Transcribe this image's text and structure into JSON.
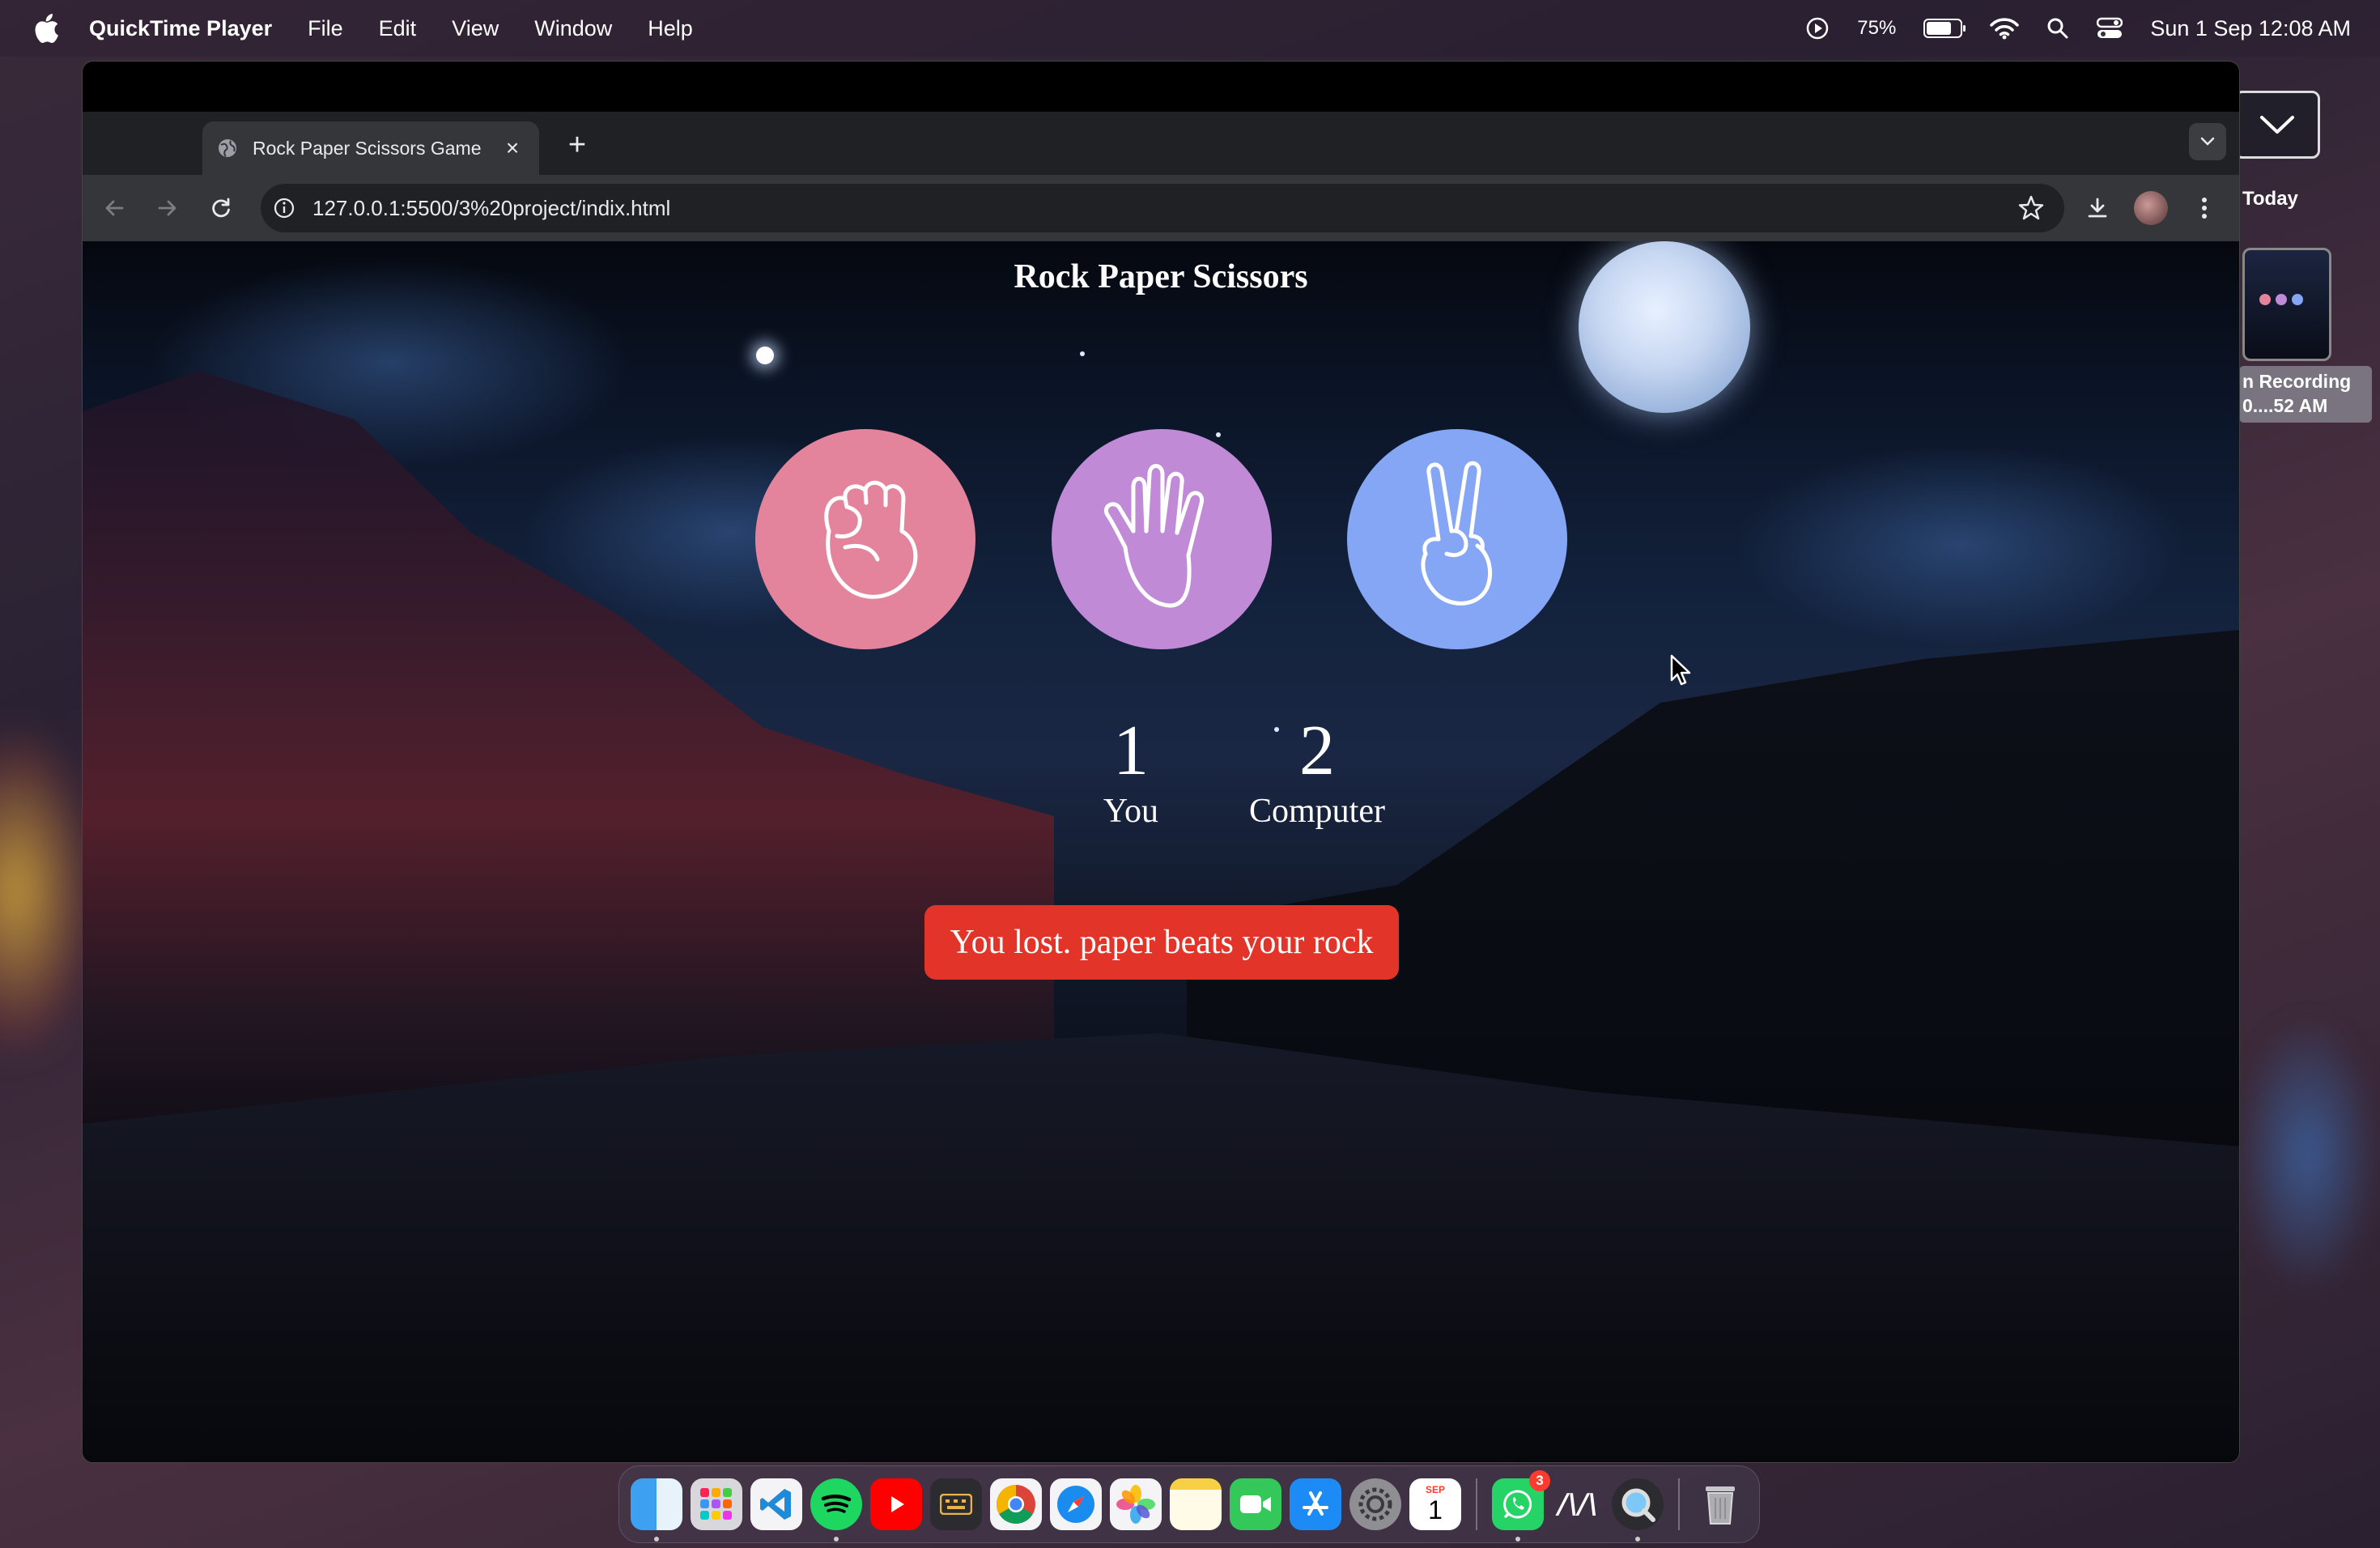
{
  "menubar": {
    "app_name": "QuickTime Player",
    "menus": [
      "File",
      "Edit",
      "View",
      "Window",
      "Help"
    ],
    "battery_percent": "75%",
    "battery_level": 0.75,
    "datetime": "Sun 1 Sep  12:08 AM"
  },
  "browser": {
    "tab_title": "Rock Paper Scissors Game",
    "url": "127.0.0.1:5500/3%20project/indix.html"
  },
  "game": {
    "title": "Rock Paper Scissors",
    "choices": [
      {
        "name": "rock",
        "color": "#e4849c"
      },
      {
        "name": "paper",
        "color": "#c08ad6"
      },
      {
        "name": "scissors",
        "color": "#85a6f5"
      }
    ],
    "user_score": "1",
    "user_label": "You",
    "computer_score": "2",
    "computer_label": "Computer",
    "message": "You lost. paper beats your rock",
    "message_color": "#e3342a"
  },
  "desktop": {
    "stack_label": "Today",
    "recording_label_line1": "n Recording",
    "recording_label_line2": "0....52 AM"
  },
  "dock": {
    "apps": [
      "finder-icon",
      "launchpad-icon",
      "vscode-icon",
      "spotify-icon",
      "youtube-icon",
      "keyboard-app-icon",
      "chrome-icon",
      "safari-icon",
      "photos-icon",
      "notes-icon",
      "facetime-icon",
      "app-store-icon",
      "system-settings-icon",
      "calendar-icon",
      "whatsapp-icon",
      "mural-icon",
      "quicktime-icon",
      "trash-icon"
    ],
    "calendar_month": "SEP",
    "calendar_day": "1",
    "whatsapp_badge": "3",
    "mural_glyph": "/\\/\\"
  }
}
